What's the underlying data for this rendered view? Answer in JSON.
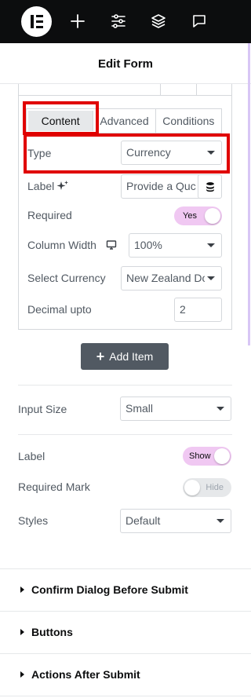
{
  "header": {
    "title": "Edit Form"
  },
  "tabs": [
    {
      "label": "Content"
    },
    {
      "label": "Advanced"
    },
    {
      "label": "Conditions"
    }
  ],
  "field_settings": {
    "type": {
      "label": "Type",
      "value": "Currency"
    },
    "label": {
      "label": "Label",
      "value": "Provide a Quc"
    },
    "required": {
      "label": "Required",
      "toggle": "Yes",
      "on": true
    },
    "column_width": {
      "label": "Column Width",
      "value": "100%"
    },
    "select_currency": {
      "label": "Select Currency",
      "value": "New Zealand Do"
    },
    "decimal_upto": {
      "label": "Decimal upto",
      "value": "2"
    }
  },
  "add_item": {
    "label": "Add Item"
  },
  "form_settings": {
    "input_size": {
      "label": "Input Size",
      "value": "Small"
    },
    "label": {
      "label": "Label",
      "toggle": "Show",
      "on": true
    },
    "required_mark": {
      "label": "Required Mark",
      "toggle": "Hide",
      "on": false
    },
    "styles": {
      "label": "Styles",
      "value": "Default"
    }
  },
  "sections": [
    {
      "label": "Confirm Dialog Before Submit"
    },
    {
      "label": "Buttons"
    },
    {
      "label": "Actions After Submit"
    }
  ],
  "colors": {
    "topbar": "#0c0d0e",
    "highlight": "#e00000",
    "toggle_on": "#f0c8f2",
    "button": "#515962"
  },
  "icons": [
    "elementor-logo-icon",
    "plus-icon",
    "sliders-icon",
    "layers-icon",
    "chat-icon",
    "sparkle-icon",
    "database-icon",
    "desktop-icon",
    "caret-right-icon",
    "caret-down-icon"
  ]
}
